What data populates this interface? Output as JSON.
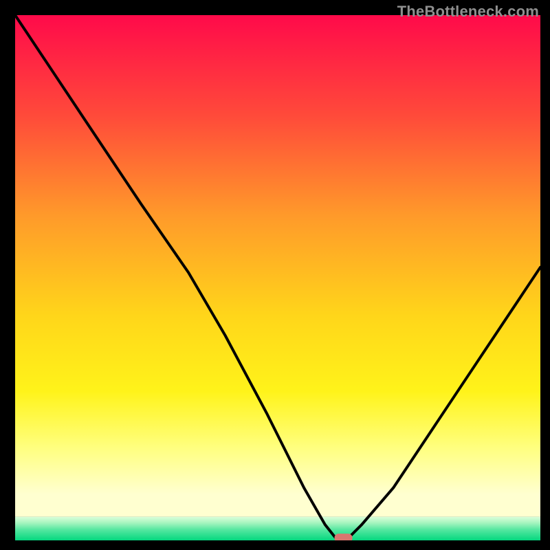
{
  "watermark": "TheBottleneck.com",
  "chart_data": {
    "type": "line",
    "title": "",
    "xlabel": "",
    "ylabel": "",
    "xlim": [
      0,
      100
    ],
    "ylim": [
      0,
      100
    ],
    "legend": false,
    "grid": false,
    "background": {
      "kind": "vertical-gradient-with-bottom-band",
      "stops": [
        {
          "pos": 0.0,
          "color": "#ff0a4a"
        },
        {
          "pos": 0.2,
          "color": "#ff4a3a"
        },
        {
          "pos": 0.4,
          "color": "#ff9a2a"
        },
        {
          "pos": 0.6,
          "color": "#ffd61a"
        },
        {
          "pos": 0.75,
          "color": "#fff31a"
        },
        {
          "pos": 0.86,
          "color": "#ffff7d"
        },
        {
          "pos": 0.955,
          "color": "#ffffd0"
        }
      ],
      "bottom_band": {
        "from": 0.955,
        "stops": [
          {
            "pos": 0.0,
            "color": "#dbffda"
          },
          {
            "pos": 0.25,
            "color": "#a8f5c0"
          },
          {
            "pos": 0.55,
            "color": "#55e7a0"
          },
          {
            "pos": 1.0,
            "color": "#05d77f"
          }
        ]
      }
    },
    "series": [
      {
        "name": "bottleneck-curve",
        "x": [
          0,
          8,
          16,
          24,
          33,
          40,
          48,
          55,
          59,
          61,
          62,
          63,
          66,
          72,
          80,
          88,
          96,
          100
        ],
        "y": [
          100,
          88,
          76,
          64,
          51,
          39,
          24,
          10,
          3,
          0.5,
          0,
          0,
          3,
          10,
          22,
          34,
          46,
          52
        ]
      }
    ],
    "marker": {
      "name": "optimal-point",
      "x": 62.5,
      "y": 0.5,
      "color": "#d9766f",
      "shape": "pill"
    },
    "notes": "Values are estimated from pixel positions; axes had no tick labels so 0–100 scales are assumed for both axes. y represents distance above the bottom of the plot (0 = bottom, 100 = top)."
  }
}
